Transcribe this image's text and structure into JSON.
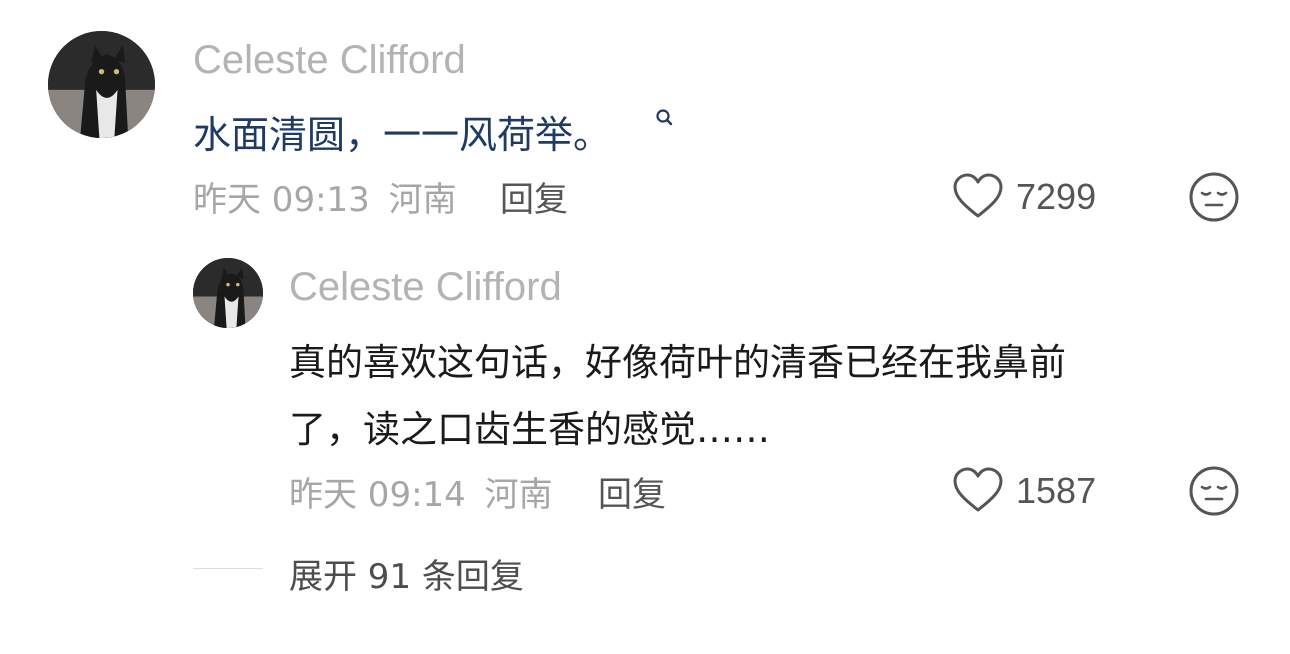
{
  "comment": {
    "author": "Celeste Clifford",
    "content": "水面清圆，一一风荷举。",
    "search_icon": "search-icon",
    "time": "昨天 09:13",
    "location": "河南",
    "reply_label": "回复",
    "like_count": "7299"
  },
  "reply_comment": {
    "author": "Celeste Clifford",
    "content_line1": "真的喜欢这句话，好像荷叶的清香已经在我鼻前",
    "content_line2": "了，读之口齿生香的感觉……",
    "time": "昨天 09:14",
    "location": "河南",
    "reply_label": "回复",
    "like_count": "1587"
  },
  "expand_replies": "展开 91 条回复",
  "colors": {
    "link_blue": "#1f3a64",
    "name_gray": "#b3b3b3",
    "meta_gray": "#a6a6a6"
  }
}
